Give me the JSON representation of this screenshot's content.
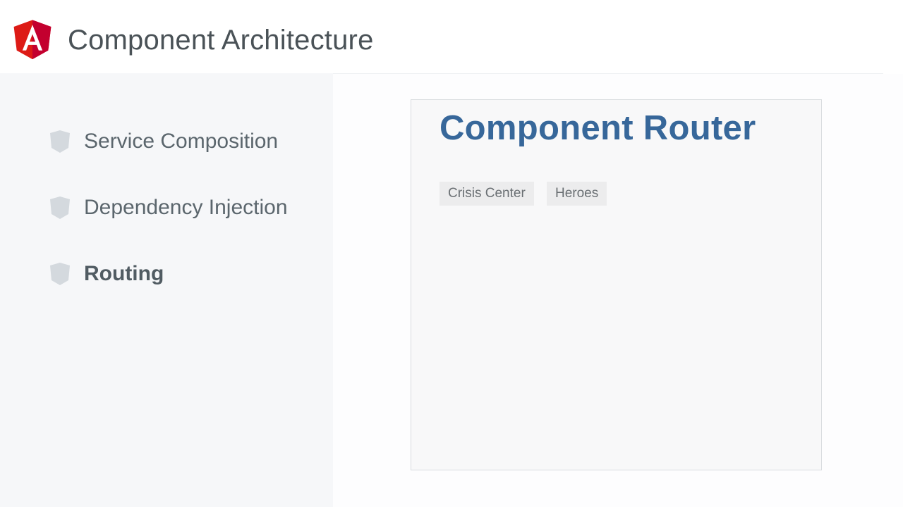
{
  "header": {
    "title": "Component Architecture",
    "logo": {
      "icon": "angular-logo-icon",
      "letter": "A",
      "colors": {
        "shield": "#dd1b16",
        "shield_dark": "#c3002f",
        "letter": "#ffffff"
      }
    }
  },
  "sidebar": {
    "items": [
      {
        "label": "Service Composition",
        "icon": "shield-bullet-icon",
        "active": false
      },
      {
        "label": "Dependency Injection",
        "icon": "shield-bullet-icon",
        "active": false
      },
      {
        "label": "Routing",
        "icon": "shield-bullet-icon",
        "active": true
      }
    ]
  },
  "demo": {
    "title": "Component Router",
    "links": [
      {
        "label": "Crisis Center"
      },
      {
        "label": "Heroes"
      }
    ]
  },
  "colors": {
    "header_text": "#4a5257",
    "sidebar_bg": "#f6f7f9",
    "demo_title": "#37679a",
    "bullet": "#d4d9de"
  }
}
